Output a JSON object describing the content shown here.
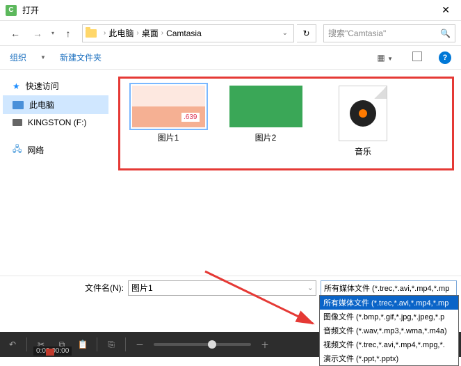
{
  "title": "打开",
  "path": {
    "root": "此电脑",
    "p1": "桌面",
    "p2": "Camtasia"
  },
  "search_placeholder": "搜索\"Camtasia\"",
  "toolbar": {
    "organize": "组织",
    "newfolder": "新建文件夹"
  },
  "sidebar": {
    "quick": "快速访问",
    "pc": "此电脑",
    "usb": "KINGSTON (F:)",
    "net": "网络"
  },
  "files": {
    "img1": "图片1",
    "img2": "图片2",
    "music": "音乐"
  },
  "filename_label": "文件名(N):",
  "filename_value": "图片1",
  "filter_selected": "所有媒体文件 (*.trec,*.avi,*.mp4,*.mp",
  "filters": {
    "all": "所有媒体文件 (*.trec,*.avi,*.mp4,*.mp",
    "image": "图像文件 (*.bmp,*.gif,*.jpg,*.jpeg,*.p",
    "audio": "音频文件 (*.wav,*.mp3,*.wma,*.m4a)",
    "video": "视频文件 (*.trec,*.avi,*.mp4,*.mpg,*.",
    "ppt": "演示文件 (*.ppt,*.pptx)"
  },
  "timeline": {
    "time": "0:00:00:00"
  }
}
